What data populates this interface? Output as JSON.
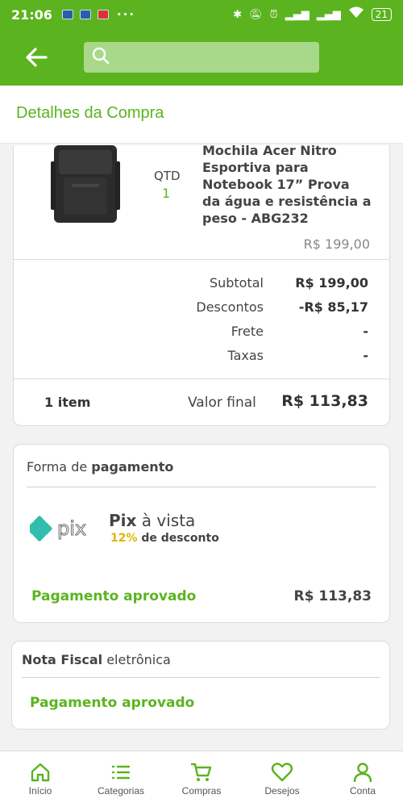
{
  "status_bar": {
    "time": "21:06",
    "battery": "21",
    "more": "···"
  },
  "search": {
    "placeholder": ""
  },
  "page": {
    "title": "Detalhes da Compra"
  },
  "product": {
    "name": "Mochila Acer Nitro Esportiva para Notebook 17” Prova da água e resistência a peso - ABG232",
    "qtd_label": "QTD",
    "qtd_value": "1",
    "price": "R$ 199,00"
  },
  "summary": {
    "rows": [
      {
        "label": "Subtotal",
        "value": "R$ 199,00"
      },
      {
        "label": "Descontos",
        "value": "-R$ 85,17"
      },
      {
        "label": "Frete",
        "value": "-"
      },
      {
        "label": "Taxas",
        "value": "-"
      }
    ],
    "items_count": "1 item",
    "final_label": "Valor final",
    "final_value": "R$ 113,83"
  },
  "payment": {
    "title_prefix": "Forma de ",
    "title_bold": "pagamento",
    "method_bold": "Pix",
    "method_rest": " à vista",
    "discount_pct": "12%",
    "discount_text": " de desconto",
    "status": "Pagamento aprovado",
    "amount": "R$ 113,83",
    "logo_text": "pix"
  },
  "nota_fiscal": {
    "title_bold": "Nota Fiscal",
    "title_rest": " eletrônica",
    "status": "Pagamento aprovado"
  },
  "nav": {
    "items": [
      {
        "label": "Início",
        "icon": "home-icon"
      },
      {
        "label": "Categorias",
        "icon": "list-icon"
      },
      {
        "label": "Compras",
        "icon": "cart-icon"
      },
      {
        "label": "Desejos",
        "icon": "heart-icon"
      },
      {
        "label": "Conta",
        "icon": "user-icon"
      }
    ]
  },
  "colors": {
    "brand_green": "#5bb41f",
    "discount_yellow": "#e0b400",
    "pix_teal": "#32bcad"
  }
}
